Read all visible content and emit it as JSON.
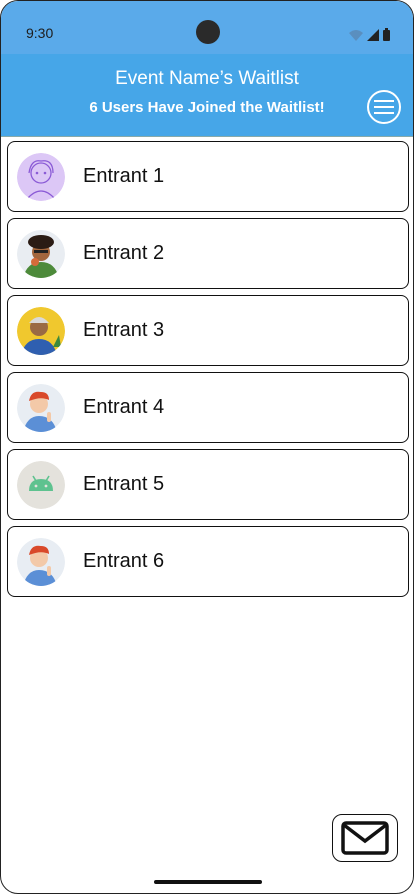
{
  "status_bar": {
    "time": "9:30"
  },
  "header": {
    "title": "Event Name’s Waitlist",
    "subtitle": "6 Users Have Joined the Waitlist!"
  },
  "entrants": [
    {
      "name": "Entrant 1",
      "avatar": "sketch-portrait-avatar"
    },
    {
      "name": "Entrant 2",
      "avatar": "curly-hair-person-avatar"
    },
    {
      "name": "Entrant 3",
      "avatar": "person-yellow-background-avatar"
    },
    {
      "name": "Entrant 4",
      "avatar": "red-hair-person-avatar"
    },
    {
      "name": "Entrant 5",
      "avatar": "android-robot-avatar"
    },
    {
      "name": "Entrant 6",
      "avatar": "red-hair-person-avatar"
    }
  ],
  "actions": {
    "mail": "mail-icon",
    "menu": "menu-icon"
  },
  "colors": {
    "header": "#46a6e8",
    "status_bar": "#5aaaea"
  }
}
